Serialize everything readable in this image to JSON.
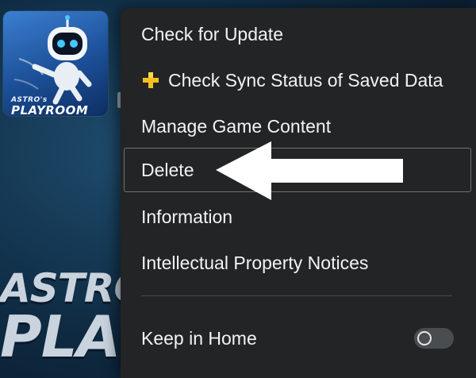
{
  "game": {
    "title_small": "ASTRO's",
    "title_big": "PLAYROOM",
    "bg_title_line1": "ASTRO",
    "bg_title_line2": "PLA"
  },
  "menu": {
    "items": [
      {
        "label": "Check for Update",
        "icon": null
      },
      {
        "label": "Check Sync Status of Saved Data",
        "icon": "ps-plus-icon"
      },
      {
        "label": "Manage Game Content",
        "icon": null
      },
      {
        "label": "Delete",
        "icon": null,
        "selected": true
      },
      {
        "label": "Information",
        "icon": null
      },
      {
        "label": "Intellectual Property Notices",
        "icon": null
      }
    ],
    "keep_in_home": {
      "label": "Keep in Home",
      "toggle_on": false
    }
  },
  "annotation": {
    "arrow_icon": "white-left-arrow-icon",
    "points_to": "Delete"
  },
  "colors": {
    "menu_bg": "#232425",
    "menu_text": "#f3f3f3",
    "ps_plus_gold": "#f4c01e",
    "background": "#0f2c44",
    "tile_blue": "#2c6bc0"
  }
}
